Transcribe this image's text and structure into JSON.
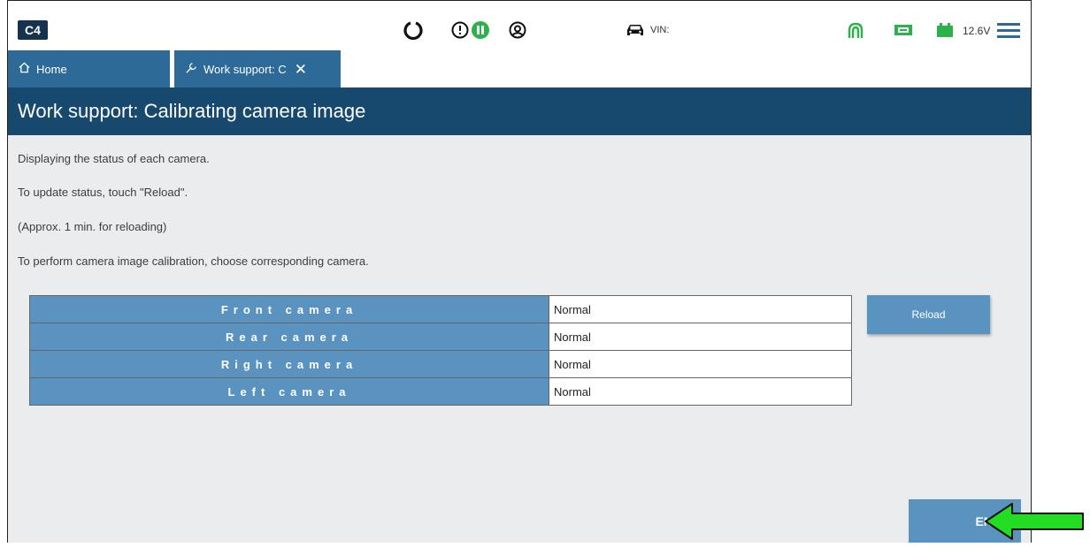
{
  "app": {
    "logo_text": "C4"
  },
  "topbar": {
    "icons": [
      "refresh-icon",
      "info-icon",
      "pause-icon",
      "user-icon",
      "car-icon",
      "signal-icon",
      "battery-status-icon",
      "battery-icon",
      "menu-icon"
    ],
    "vin_label": "VIN:",
    "voltage": "12.6V",
    "accent_green": "#2cb24a",
    "icon_dark": "#222222"
  },
  "tabs": [
    {
      "label": "Home",
      "icon": "home-icon"
    },
    {
      "label": "Work support: C",
      "icon": "wrench-icon",
      "active": true
    }
  ],
  "page": {
    "title": "Work support: Calibrating camera image",
    "descriptions": [
      "Displaying the status of each camera.",
      "To update status, touch \"Reload\".",
      "(Approx. 1 min. for reloading)",
      "To perform camera image calibration, choose corresponding camera."
    ]
  },
  "cameras": [
    {
      "name": "Front camera",
      "status": "Normal"
    },
    {
      "name": "Rear camera",
      "status": "Normal"
    },
    {
      "name": "Right camera",
      "status": "Normal"
    },
    {
      "name": "Left camera",
      "status": "Normal"
    }
  ],
  "buttons": {
    "reload": "Reload",
    "end": "END"
  },
  "colors": {
    "header_blue": "#17496f",
    "tab_blue": "#2d6a97",
    "cell_blue": "#5b93c0",
    "arrow_green": "#22dd22"
  }
}
